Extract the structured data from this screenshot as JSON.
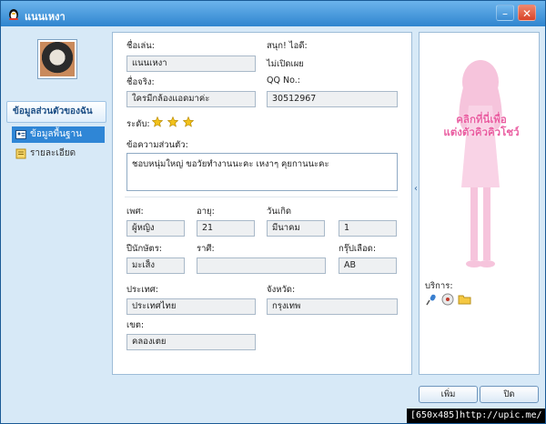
{
  "window": {
    "title": "แนนเหงา"
  },
  "sidebar": {
    "header": "ข้อมูลส่วนตัวของฉัน",
    "items": [
      {
        "label": "ข้อมูลพื้นฐาน",
        "active": true
      },
      {
        "label": "รายละเอียด",
        "active": false
      }
    ]
  },
  "profile": {
    "nickname": {
      "label": "ชื่อเล่น:",
      "value": "แนนเหงา"
    },
    "fun_id": {
      "label": "สนุก! ไอดี:",
      "value": "ไม่เปิดเผย"
    },
    "real_name": {
      "label": "ชื่อจริง:",
      "value": "ใครมีกล้องแอดมาค่ะ"
    },
    "qq": {
      "label": "QQ No.:",
      "value": "30512967"
    },
    "level": {
      "label": "ระดับ:",
      "stars": 3
    },
    "about": {
      "label": "ข้อความส่วนตัว:",
      "value": "ชอบหนุ่มใหญ่ ขอวัยทำงานนะคะ เหงาๆ คุยกานนะคะ"
    },
    "gender": {
      "label": "เพศ:",
      "value": "ผู้หญิง"
    },
    "age": {
      "label": "อายุ:",
      "value": "21"
    },
    "birthday": {
      "label": "วันเกิด",
      "month": "มีนาคม",
      "day": "1"
    },
    "zodiac": {
      "label": "ปีนักษัตร:",
      "value": "มะเส็ง"
    },
    "sign": {
      "label": "ราศี:",
      "value": ""
    },
    "blood": {
      "label": "กรุ๊ปเลือด:",
      "value": "AB"
    },
    "country": {
      "label": "ประเทศ:",
      "value": "ประเทศไทย"
    },
    "province": {
      "label": "จังหวัด:",
      "value": "กรุงเทพ"
    },
    "district": {
      "label": "เขต:",
      "value": "คลองเตย"
    }
  },
  "right_panel": {
    "promo_line1": "คลิกที่นี่เพื่อ",
    "promo_line2": "แต่งตัวคิวคิวโชว์",
    "services_label": "บริการ:",
    "icons": [
      "microphone-icon",
      "music-disc-icon",
      "folder-icon"
    ]
  },
  "buttons": {
    "add": "เพิ่ม",
    "close": "ปิด"
  },
  "watermark": "[650x485]http://upic.me/",
  "colors": {
    "titlebar": "#2f85cf",
    "active_nav": "#2f86d6",
    "promo_pink": "#ea5fa2",
    "star": "#f2c21b"
  }
}
